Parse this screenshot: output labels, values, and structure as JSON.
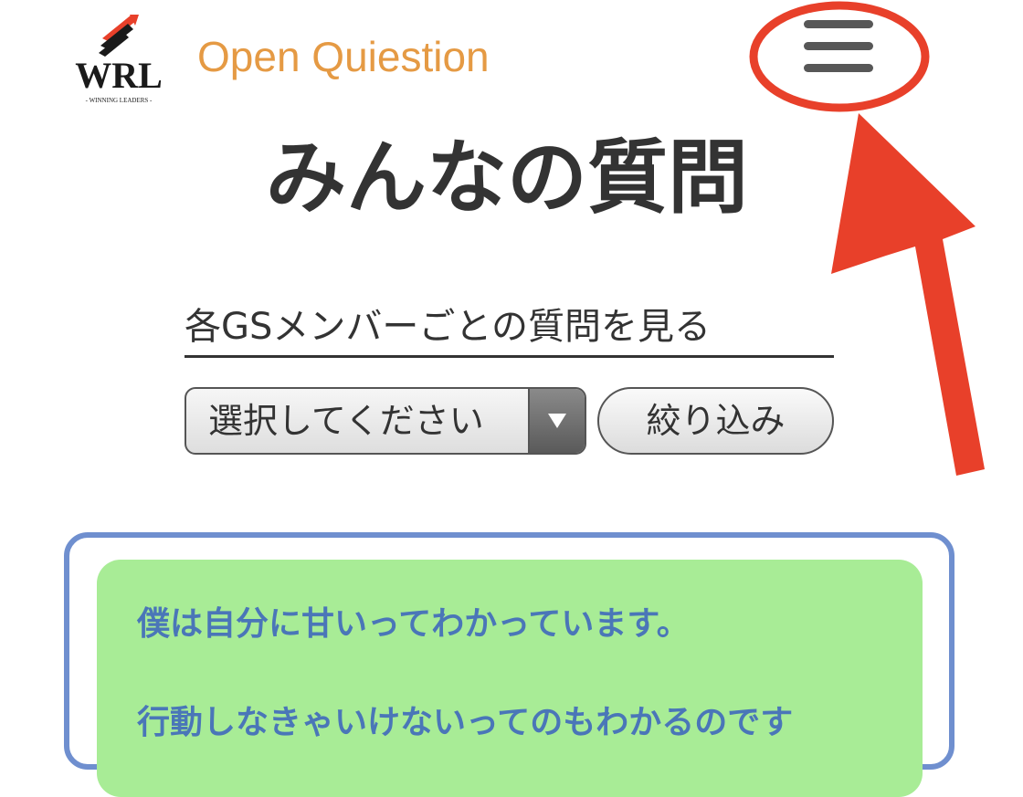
{
  "header": {
    "logo_text": "WRL",
    "logo_subtext": "- WINNING LEADERS -",
    "site_title": "Open Quiestion",
    "menu_icon": "hamburger-menu-icon"
  },
  "page": {
    "title": "みんなの質問"
  },
  "filter": {
    "heading": "各GSメンバーごとの質問を見る",
    "select_value": "選択してください",
    "select_icon": "triangle-down-icon",
    "button_label": "絞り込み"
  },
  "question": {
    "lines": [
      "僕は自分に甘いってわかっています。",
      "行動しなきゃいけないってのもわかるのです"
    ]
  },
  "colors": {
    "site_title": "#e59a44",
    "annotation": "#e8402a",
    "card_border": "#6f8fcf",
    "bubble": "#a8ec96",
    "question_text": "#4a76b8"
  }
}
